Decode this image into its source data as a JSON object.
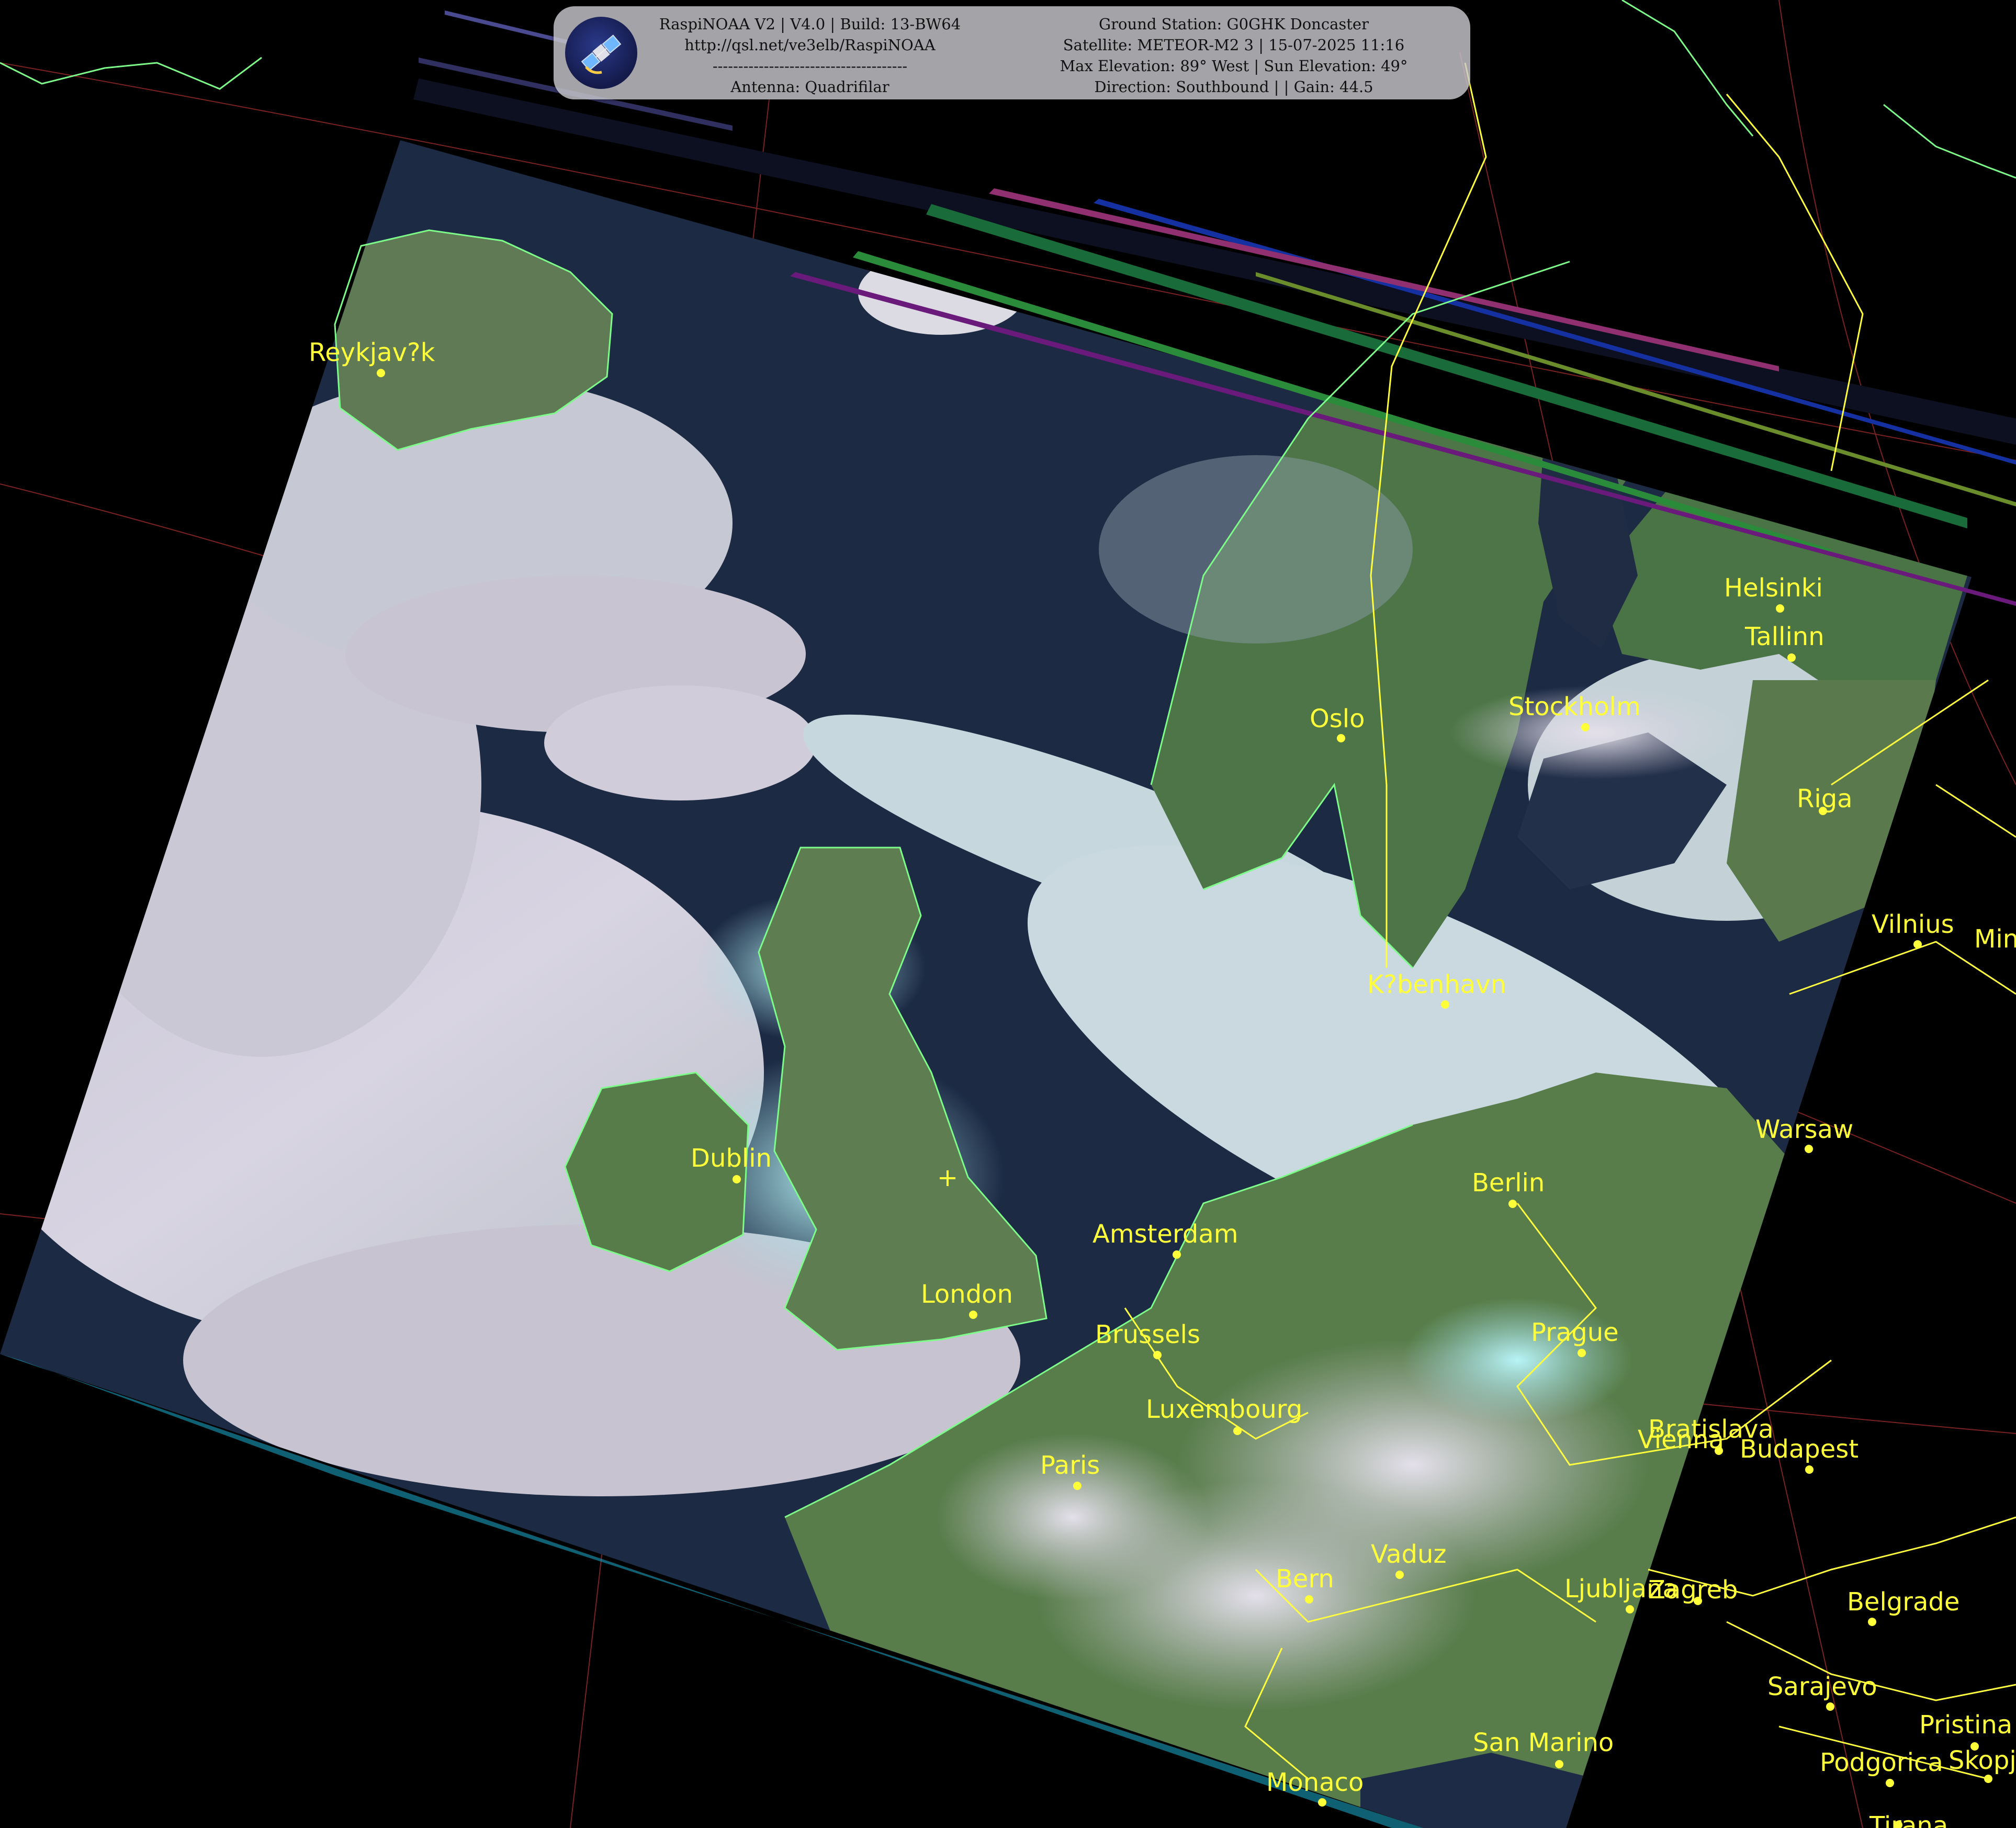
{
  "header": {
    "left_lines": [
      "RaspiNOAA V2 | V4.0 | Build: 13-BW64",
      "http://qsl.net/ve3elb/RaspiNOAA",
      "--------------------------------------",
      "Antenna: Quadrifilar"
    ],
    "right_lines": [
      "Ground Station: G0GHK Doncaster",
      "Satellite: METEOR-M2 3 | 15-07-2025 11:16",
      "Max Elevation: 89° West | Sun Elevation: 49°",
      "Direction: Southbound | | Gain: 44.5"
    ],
    "logo_icon": "satellite-icon"
  },
  "colors": {
    "background": "#000000",
    "city_label": "#ffff3a",
    "coastline": "#7dfc8a",
    "border": "#ffff40",
    "graticule": "#b03030"
  },
  "cities": [
    {
      "name": "Reykjav?k"
    },
    {
      "name": "Helsinki"
    },
    {
      "name": "Tallinn"
    },
    {
      "name": "Oslo"
    },
    {
      "name": "Stockholm"
    },
    {
      "name": "Riga"
    },
    {
      "name": "Vilnius"
    },
    {
      "name": "Min"
    },
    {
      "name": "K?benhavn"
    },
    {
      "name": "Warsaw"
    },
    {
      "name": "Dublin"
    },
    {
      "name": "Berlin"
    },
    {
      "name": "Amsterdam"
    },
    {
      "name": "London"
    },
    {
      "name": "Brussels"
    },
    {
      "name": "Prague"
    },
    {
      "name": "Luxembourg"
    },
    {
      "name": "Bratislava"
    },
    {
      "name": "Vienna"
    },
    {
      "name": "Budapest"
    },
    {
      "name": "Paris"
    },
    {
      "name": "Vaduz"
    },
    {
      "name": "Bern"
    },
    {
      "name": "Ljubljana"
    },
    {
      "name": "Zagreb"
    },
    {
      "name": "Belgrade"
    },
    {
      "name": "Sarajevo"
    },
    {
      "name": "Pristina"
    },
    {
      "name": "San Marino"
    },
    {
      "name": "Podgorica"
    },
    {
      "name": "Skopje"
    },
    {
      "name": "Monaco"
    },
    {
      "name": "Tirana"
    }
  ]
}
